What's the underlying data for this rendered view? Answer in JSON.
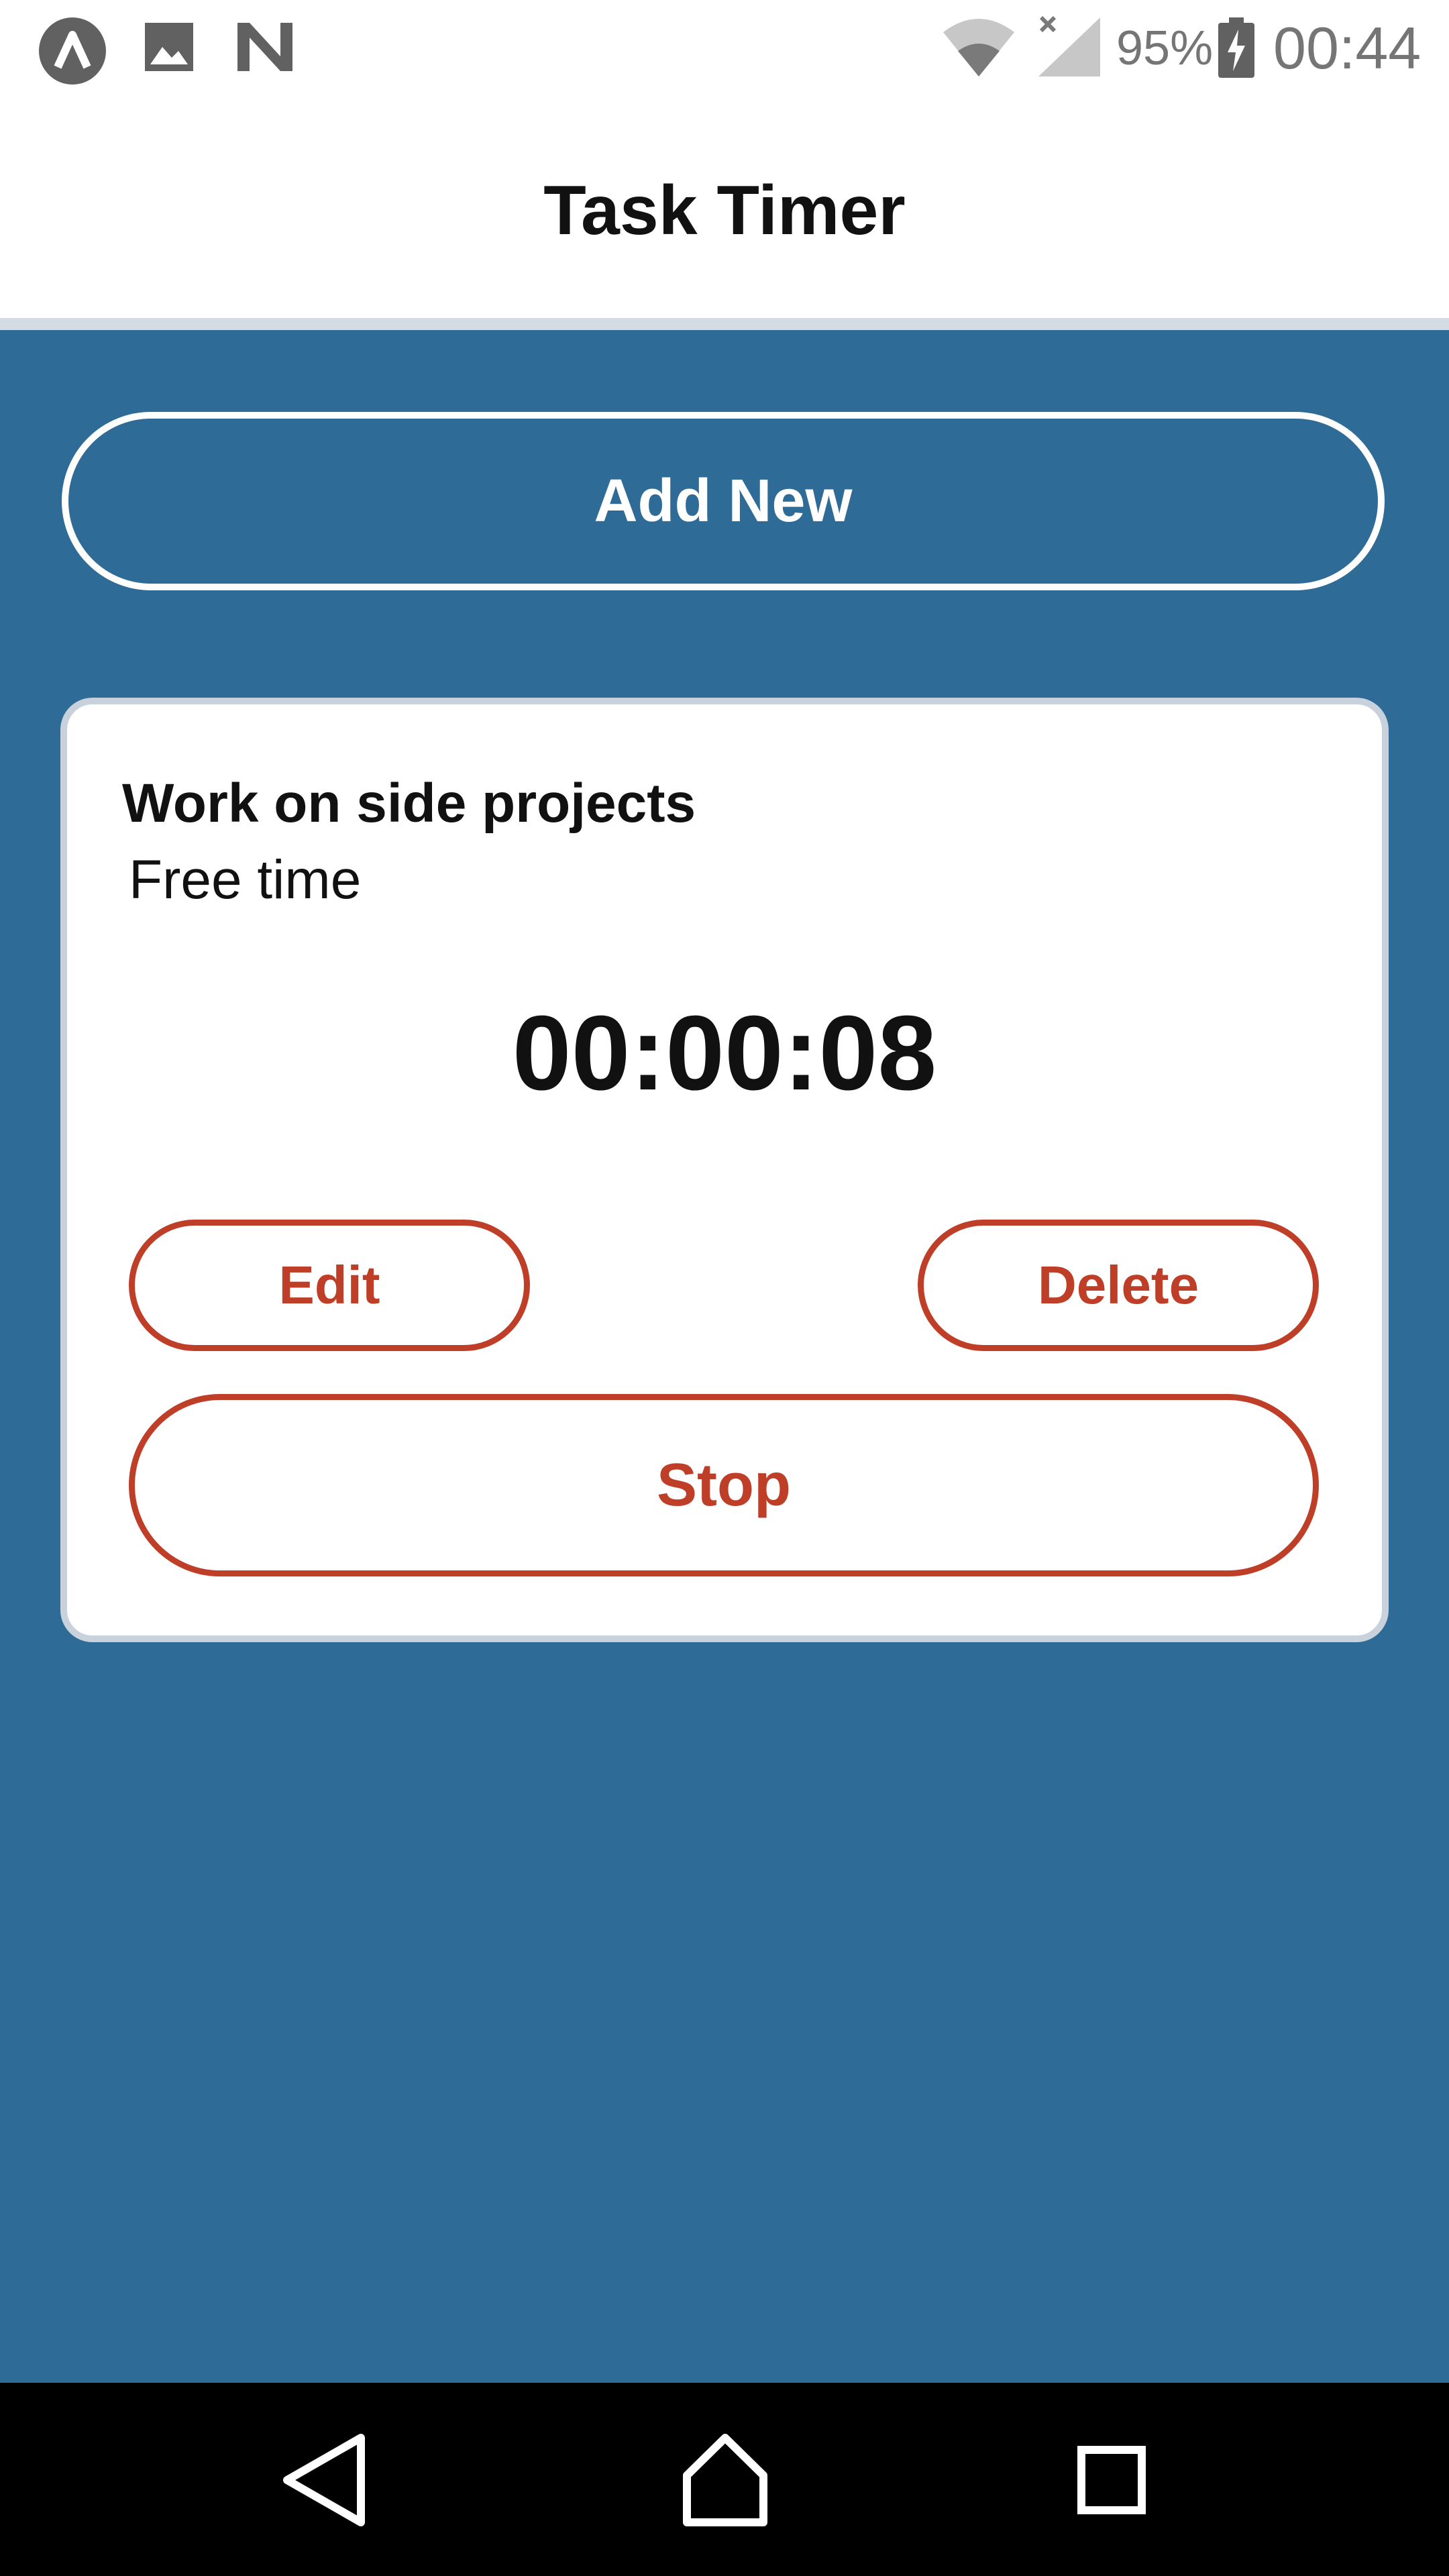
{
  "status_bar": {
    "battery_percent": "95%",
    "time": "00:44",
    "icons": [
      "app-notification-icon",
      "image-notification-icon",
      "n-notification-icon",
      "wifi-icon",
      "signal-icon",
      "battery-charging-icon"
    ]
  },
  "header": {
    "title": "Task Timer"
  },
  "main": {
    "add_new_label": "Add New",
    "tasks": [
      {
        "name": "Work on side projects",
        "category": "Free time",
        "elapsed": "00:00:08",
        "edit_label": "Edit",
        "delete_label": "Delete",
        "stop_label": "Stop"
      }
    ]
  },
  "nav_bar": {
    "icons": [
      "back-icon",
      "home-icon",
      "recents-icon"
    ]
  },
  "colors": {
    "background": "#2E6B96",
    "accent": "#BE3E28",
    "surface": "#FFFFFF"
  }
}
